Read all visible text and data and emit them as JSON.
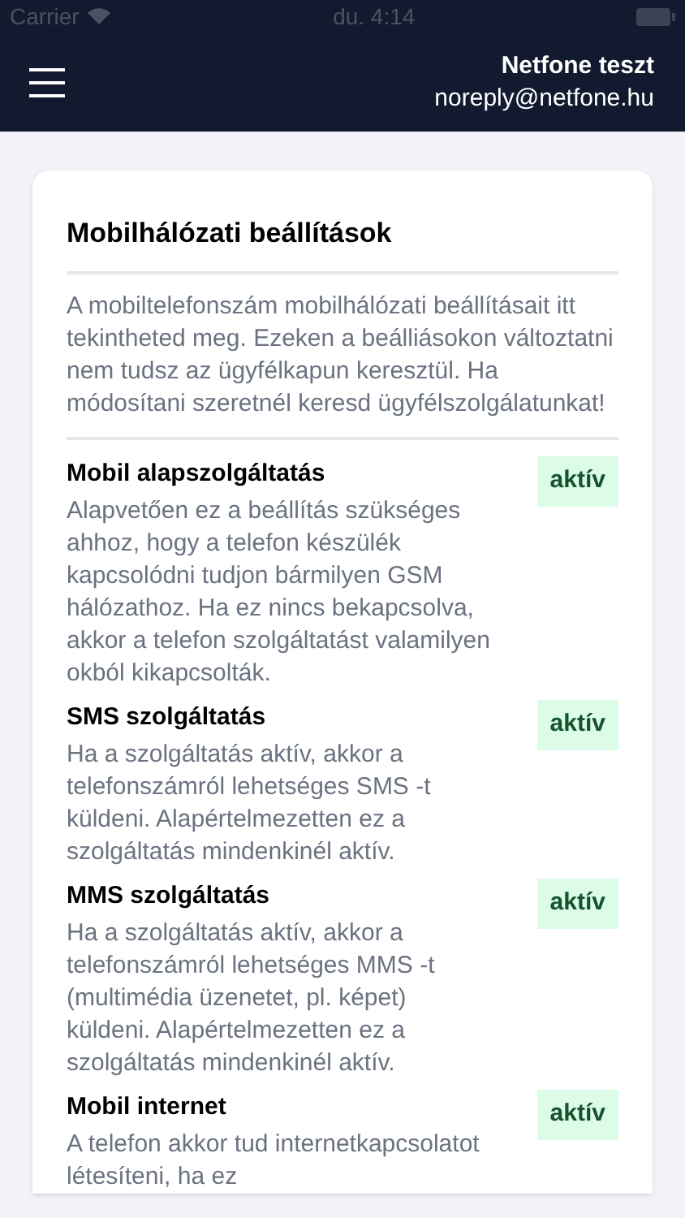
{
  "status_bar": {
    "carrier": "Carrier",
    "time": "du. 4:14"
  },
  "header": {
    "name": "Netfone teszt",
    "email": "noreply@netfone.hu"
  },
  "card": {
    "title": "Mobilhálózati beállítások",
    "intro": "A mobiltelefonszám mobilhálózati beállításait itt tekintheted meg. Ezeken a beálliásokon változtatni nem tudsz az ügyfélkapun keresztül. Ha módosítani szeretnél keresd ügyfélszolgálatunkat!",
    "services": [
      {
        "name": "Mobil alapszolgáltatás",
        "description": "Alapvetően ez a beállítás szükséges ahhoz, hogy a telefon készülék kapcsolódni tudjon bármilyen GSM hálózathoz. Ha ez nincs bekapcsolva, akkor a telefon szolgáltatást valamilyen okból kikapcsolták.",
        "status": "aktív",
        "active": true
      },
      {
        "name": "SMS szolgáltatás",
        "description": "Ha a szolgáltatás aktív, akkor a telefonszámról lehetséges SMS -t küldeni. Alapértelmezetten ez a szolgáltatás mindenkinél aktív.",
        "status": "aktív",
        "active": true
      },
      {
        "name": "MMS szolgáltatás",
        "description": "Ha a szolgáltatás aktív, akkor a telefonszámról lehetséges MMS -t (multimédia üzenetet, pl. képet) küldeni. Alapértelmezetten ez a szolgáltatás mindenkinél aktív.",
        "status": "aktív",
        "active": true
      },
      {
        "name": "Mobil internet",
        "description": "A telefon akkor tud internetkapcsolatot létesíteni, ha ez",
        "status": "aktív",
        "active": true
      }
    ]
  }
}
